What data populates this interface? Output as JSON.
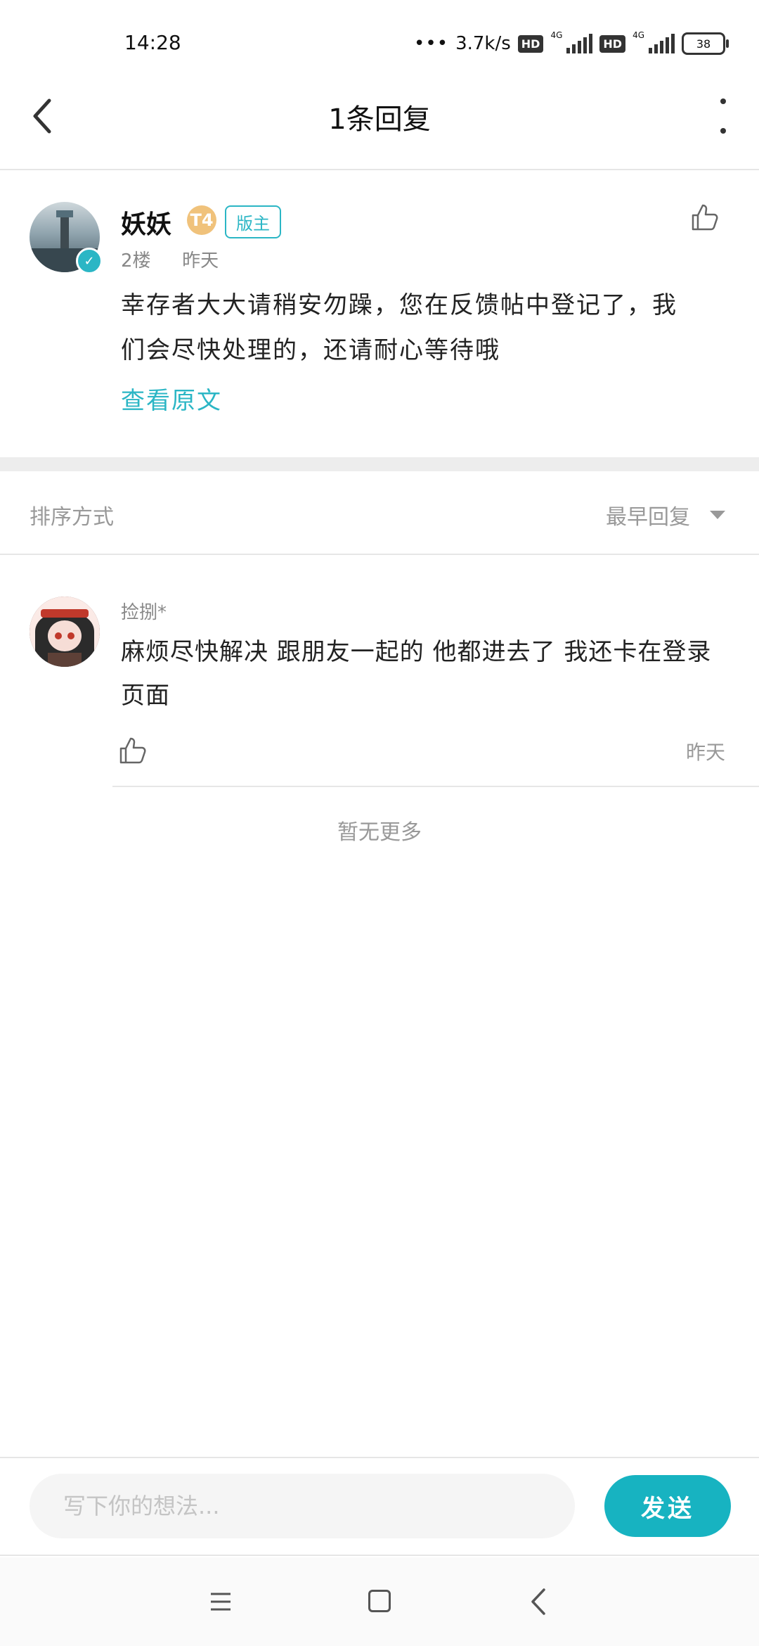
{
  "status_bar": {
    "time": "14:28",
    "network_speed": "3.7k/s",
    "hd_label": "HD",
    "network_type": "4G",
    "battery": "38"
  },
  "header": {
    "title": "1条回复"
  },
  "original_post": {
    "username": "妖妖",
    "level": "T4",
    "role_badge": "版主",
    "floor": "2楼",
    "time": "昨天",
    "content": "幸存者大大请稍安勿躁，您在反馈帖中登记了，我们会尽快处理的，还请耐心等待哦",
    "view_original": "查看原文"
  },
  "sort": {
    "label": "排序方式",
    "value": "最早回复"
  },
  "comments": [
    {
      "username": "捡捌*",
      "content": "麻烦尽快解决  跟朋友一起的 他都进去了 我还卡在登录页面",
      "time": "昨天"
    }
  ],
  "no_more": "暂无更多",
  "input": {
    "placeholder": "写下你的想法...",
    "value": "",
    "send_label": "发送"
  },
  "colors": {
    "accent": "#2bb6c5",
    "send_button": "#17b3c1",
    "level_badge": "#f0c27b"
  }
}
